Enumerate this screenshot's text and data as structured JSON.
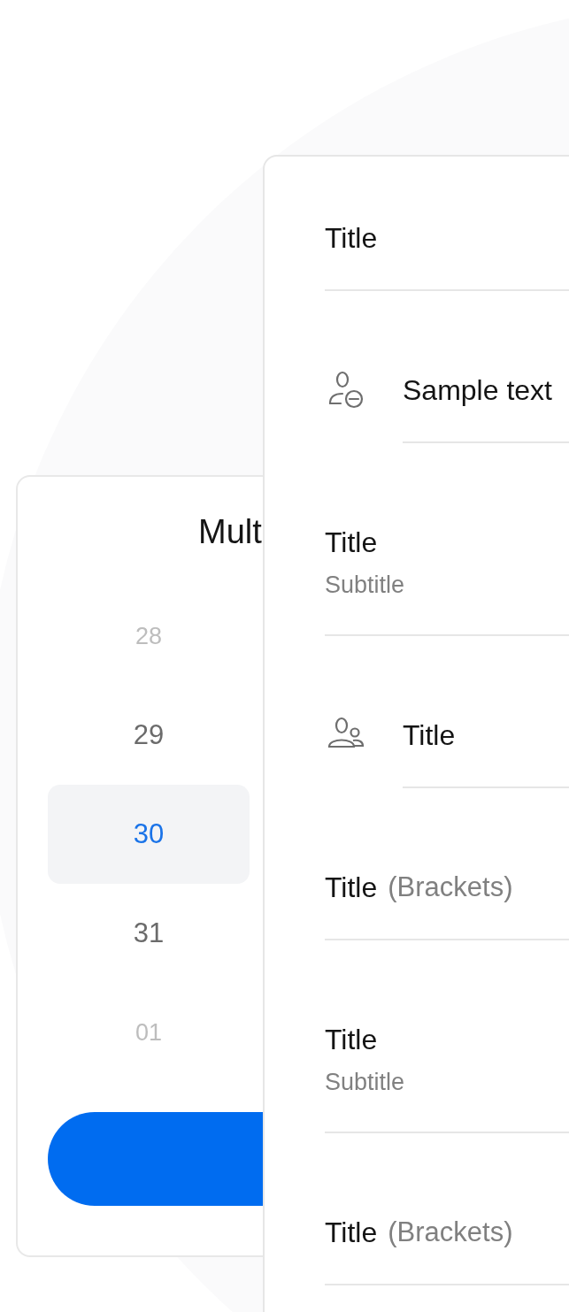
{
  "picker": {
    "title": "Mult",
    "days": [
      {
        "label": "28",
        "selected": false,
        "faded": true
      },
      {
        "label": "29",
        "selected": false,
        "faded": false
      },
      {
        "label": "30",
        "selected": true,
        "faded": false
      },
      {
        "label": "31",
        "selected": false,
        "faded": false
      },
      {
        "label": "01",
        "selected": false,
        "faded": true
      }
    ]
  },
  "list": [
    {
      "kind": "single",
      "title": "Title"
    },
    {
      "kind": "usericon",
      "title": "Sample text"
    },
    {
      "kind": "subtitle",
      "title": "Title",
      "subtitle": "Subtitle"
    },
    {
      "kind": "groupicon",
      "title": "Title"
    },
    {
      "kind": "bracket",
      "title": "Title",
      "note": "(Brackets)"
    },
    {
      "kind": "subtitle",
      "title": "Title",
      "subtitle": "Subtitle"
    },
    {
      "kind": "bracket",
      "title": "Title",
      "note": "(Brackets)"
    }
  ]
}
